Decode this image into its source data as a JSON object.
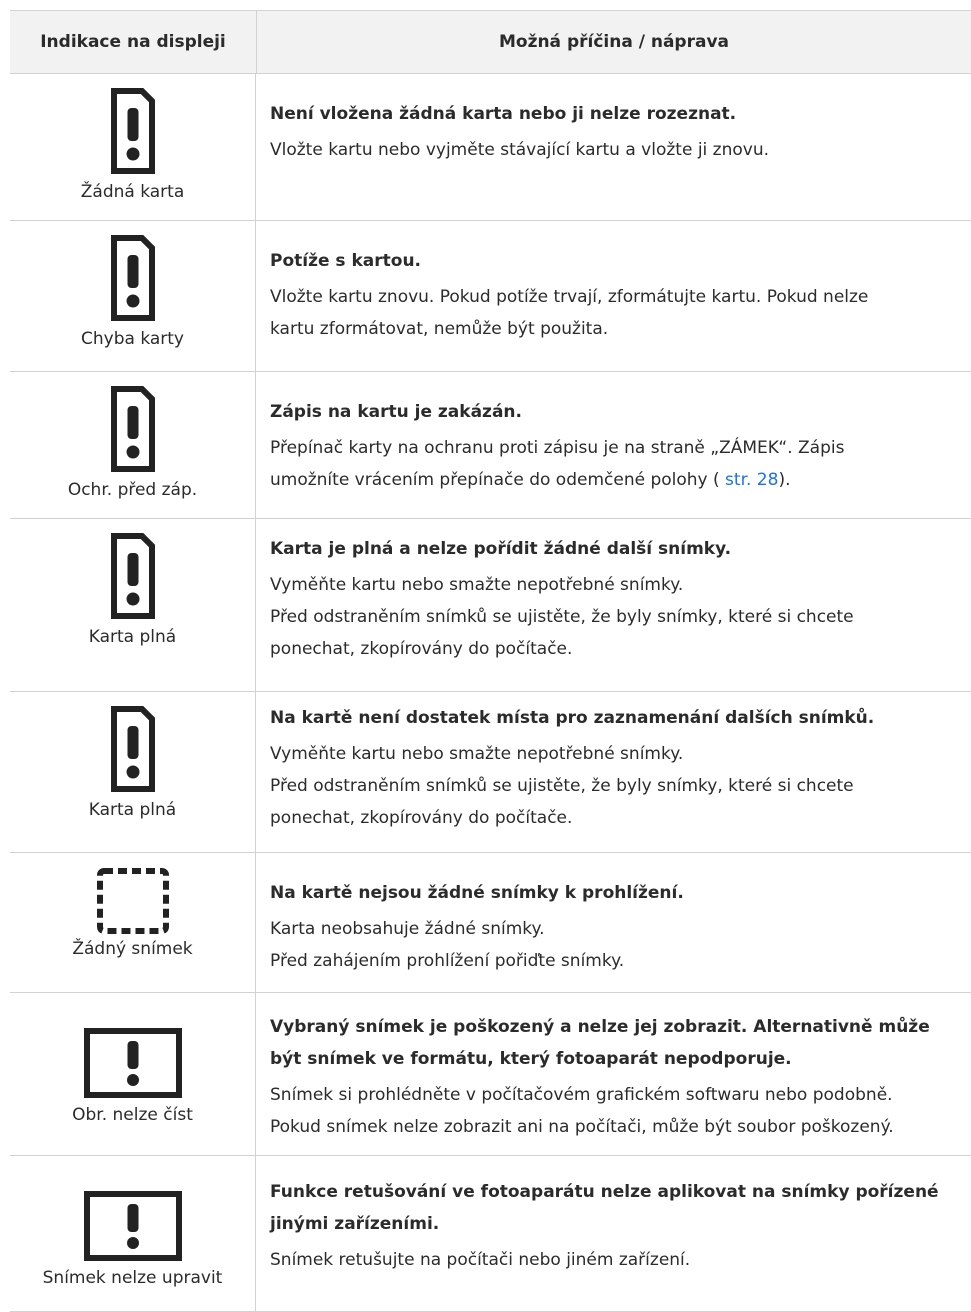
{
  "header": {
    "col1": "Indikace na displeji",
    "col2": "Možná příčina / náprava"
  },
  "rows": [
    {
      "icon": "card-warning-icon",
      "label": "Žádná karta",
      "title": "Není vložena žádná karta nebo ji nelze rozeznat.",
      "lines": [
        "Vložte kartu nebo vyjměte stávající kartu a vložte ji znovu."
      ]
    },
    {
      "icon": "card-warning-icon",
      "label": "Chyba karty",
      "title": "Potíže s kartou.",
      "lines": [
        "Vložte kartu znovu. Pokud potíže trvají, zformátujte kartu. Pokud nelze",
        "kartu zformátovat, nemůže být použita."
      ]
    },
    {
      "icon": "card-warning-icon",
      "label": "Ochr. před záp.",
      "title": "Zápis na kartu je zakázán.",
      "lines": [
        "Přepínač karty na ochranu proti zápisu je na straně „ZÁMEK“. Zápis"
      ],
      "line2_before": "umožníte vrácením přepínače do odemčené polohy ( ",
      "line2_link": "str. 28",
      "line2_after": ")."
    },
    {
      "icon": "card-warning-icon",
      "label": "Karta plná",
      "title": "Karta je plná a nelze pořídit žádné další snímky.",
      "lines": [
        "Vyměňte kartu nebo smažte nepotřebné snímky.",
        "Před odstraněním snímků se ujistěte, že byly snímky, které si chcete",
        "ponechat, zkopírovány do počítače."
      ]
    },
    {
      "icon": "card-warning-icon",
      "label": "Karta plná",
      "title": "Na kartě není dostatek místa pro zaznamenání dalších snímků.",
      "lines": [
        "Vyměňte kartu nebo smažte nepotřebné snímky.",
        "Před odstraněním snímků se ujistěte, že byly snímky, které si chcete",
        "ponechat, zkopírovány do počítače."
      ]
    },
    {
      "icon": "no-image-icon",
      "label": "Žádný snímek",
      "title": "Na kartě nejsou žádné snímky k prohlížení.",
      "lines": [
        "Karta neobsahuje žádné snímky.",
        "Před zahájením prohlížení pořiďte snímky."
      ]
    },
    {
      "icon": "image-warning-icon",
      "label": "Obr. nelze číst",
      "title_lines": [
        "Vybraný snímek je poškozený a nelze jej zobrazit. Alternativně může",
        "být snímek ve formátu, který fotoaparát nepodporuje."
      ],
      "lines": [
        "Snímek si prohlédněte v počítačovém grafickém softwaru nebo podobně.",
        "Pokud snímek nelze zobrazit ani na počítači, může být soubor poškozený."
      ]
    },
    {
      "icon": "image-warning-icon",
      "label": "Snímek nelze upravit",
      "title_lines": [
        "Funkce retušování ve fotoaparátu nelze aplikovat na snímky pořízené",
        "jinými zařízeními."
      ],
      "lines": [
        "Snímek retušujte na počítači nebo jiném zařízení."
      ]
    }
  ]
}
